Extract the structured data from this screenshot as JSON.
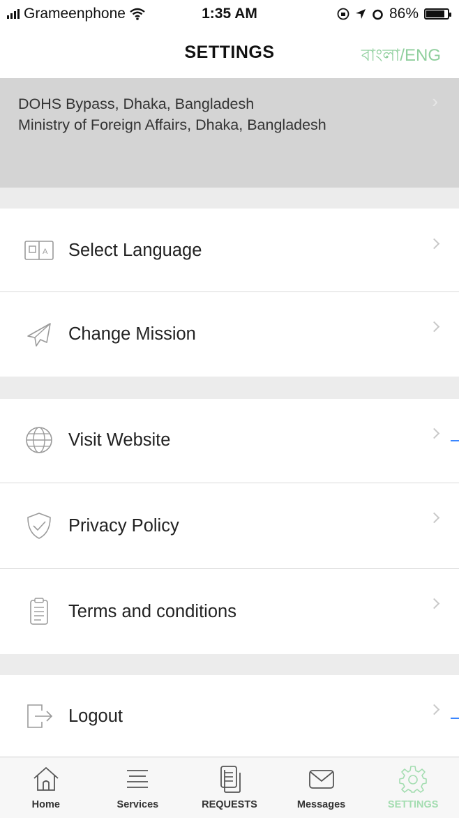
{
  "status_bar": {
    "carrier": "Grameenphone",
    "time": "1:35 AM",
    "battery": "86%",
    "battery_level": 0.86
  },
  "nav": {
    "title": "SETTINGS",
    "language_toggle": "বাংলা/ENG"
  },
  "address": {
    "line1": "DOHS Bypass, Dhaka, Bangladesh",
    "line2": "Ministry of Foreign Affairs, Dhaka, Bangladesh"
  },
  "menu": {
    "select_language": "Select Language",
    "change_mission": "Change Mission",
    "visit_website": "Visit Website",
    "privacy_policy": "Privacy Policy",
    "terms": "Terms and conditions",
    "logout": "Logout"
  },
  "tabs": {
    "home": "Home",
    "services": "Services",
    "requests": "REQUESTS",
    "messages": "Messages",
    "settings": "SETTINGS"
  },
  "colors": {
    "accent_green": "#8fcf9d",
    "active_tab": "#a4ddb1",
    "address_bg": "#d4d4d4",
    "separator_bg": "#ececec"
  }
}
